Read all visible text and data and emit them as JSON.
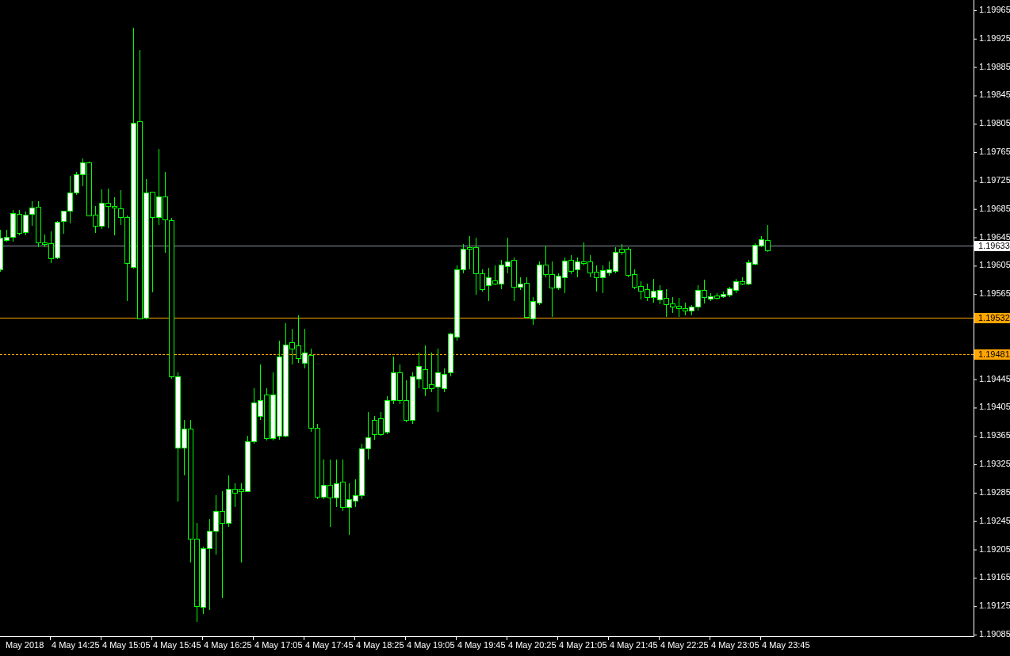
{
  "price_axis": {
    "labels": [
      "1.19965",
      "1.19925",
      "1.19885",
      "1.19845",
      "1.19805",
      "1.19765",
      "1.19725",
      "1.19685",
      "1.19645",
      "1.19605",
      "1.19565",
      "1.19445",
      "1.19405",
      "1.19365",
      "1.19325",
      "1.19285",
      "1.19245",
      "1.19205",
      "1.19165",
      "1.19125",
      "1.19085"
    ]
  },
  "price_lines": [
    {
      "label": "1.19633",
      "kind": "solid",
      "color": "#8c96a0"
    },
    {
      "label": "1.19532",
      "kind": "solid",
      "color": "#ffa500"
    },
    {
      "label": "1.19481",
      "kind": "dashed",
      "color": "#ffa500"
    }
  ],
  "time_axis": {
    "labels": [
      "May 2018",
      "4 May 14:25",
      "4 May 15:05",
      "4 May 15:45",
      "4 May 16:25",
      "4 May 17:05",
      "4 May 17:45",
      "4 May 18:25",
      "4 May 19:05",
      "4 May 19:45",
      "4 May 20:25",
      "4 May 21:05",
      "4 May 21:45",
      "4 May 22:25",
      "4 May 23:05",
      "4 May 23:45"
    ]
  }
}
